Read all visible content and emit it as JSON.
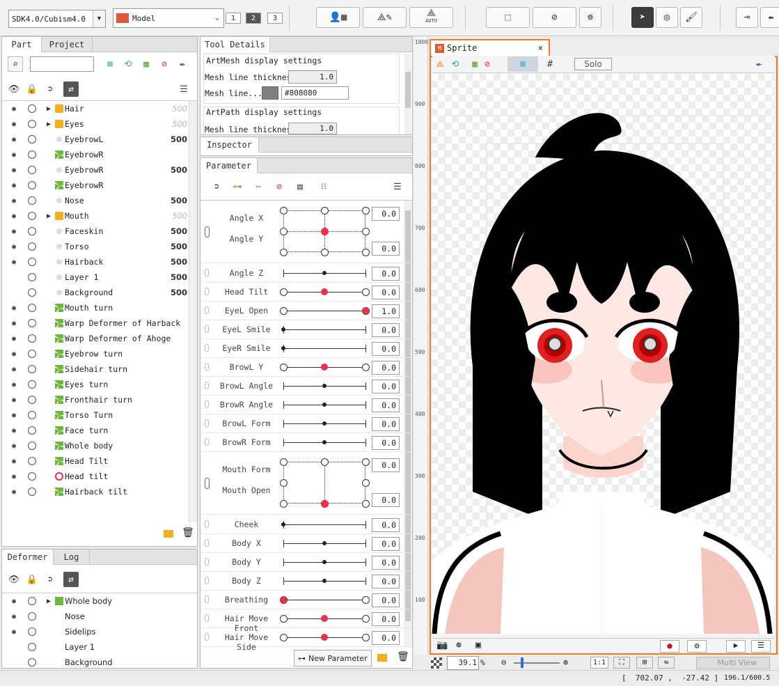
{
  "toolbar": {
    "sdk_select": "SDK4.0/Cubism4.0",
    "mode_select": "Model",
    "view_buttons": [
      "1",
      "2",
      "3"
    ],
    "selected_view": "2",
    "auto_label": "AUTO"
  },
  "part_panel": {
    "tabs": [
      "Part",
      "Project"
    ],
    "search_placeholder": "",
    "items": [
      {
        "label": "Hair",
        "order": "500",
        "folder": true,
        "expand": true,
        "visible": true,
        "dim": true
      },
      {
        "label": "Eyes",
        "order": "500",
        "folder": true,
        "expand": true,
        "visible": true,
        "dim": true
      },
      {
        "label": "EyebrowL",
        "order": "500",
        "icon": "mesh-icon",
        "visible": true
      },
      {
        "label": "EyebrowR",
        "order": "",
        "icon": "warp-icon",
        "visible": true
      },
      {
        "label": "EyebrowR",
        "order": "500",
        "icon": "mesh-icon",
        "visible": true
      },
      {
        "label": "EyebrowR",
        "order": "",
        "icon": "warp-icon",
        "visible": true
      },
      {
        "label": "Nose",
        "order": "500",
        "icon": "mesh-icon",
        "visible": true
      },
      {
        "label": "Mouth",
        "order": "500",
        "folder": true,
        "expand": true,
        "visible": true,
        "dim": true
      },
      {
        "label": "Faceskin",
        "order": "500",
        "icon": "mesh-icon",
        "visible": true
      },
      {
        "label": "Torso",
        "order": "500",
        "icon": "mesh-icon",
        "visible": true
      },
      {
        "label": "Hairback",
        "order": "500",
        "icon": "mesh-icon",
        "visible": true
      },
      {
        "label": "Layer 1",
        "order": "500",
        "icon": "mesh-icon",
        "visible": false
      },
      {
        "label": "Background",
        "order": "500",
        "icon": "mesh-icon",
        "visible": false
      },
      {
        "label": "Mouth turn",
        "order": "",
        "icon": "warp-icon",
        "visible": true
      },
      {
        "label": "Warp Deformer of Harback",
        "order": "",
        "icon": "warp-icon",
        "visible": true
      },
      {
        "label": "Warp Deformer of Ahoge",
        "order": "",
        "icon": "warp-icon",
        "visible": true
      },
      {
        "label": "Eyebrow turn",
        "order": "",
        "icon": "warp-icon",
        "visible": true
      },
      {
        "label": "Sidehair turn",
        "order": "",
        "icon": "warp-icon",
        "visible": true
      },
      {
        "label": "Eyes turn",
        "order": "",
        "icon": "warp-icon",
        "visible": true
      },
      {
        "label": "Fronthair turn",
        "order": "",
        "icon": "warp-icon",
        "visible": true
      },
      {
        "label": "Torso Turn",
        "order": "",
        "icon": "warp-icon",
        "visible": true
      },
      {
        "label": "Face turn",
        "order": "",
        "icon": "warp-icon",
        "visible": true
      },
      {
        "label": "Whole body",
        "order": "",
        "icon": "warp-icon",
        "visible": true
      },
      {
        "label": "Head Tilt",
        "order": "",
        "icon": "warp-icon",
        "visible": true
      },
      {
        "label": "Head tilt",
        "order": "",
        "icon": "rotation-icon",
        "visible": true
      },
      {
        "label": "Hairback tilt",
        "order": "",
        "icon": "warp-icon",
        "visible": true
      }
    ]
  },
  "deformer_panel": {
    "tabs": [
      "Deformer",
      "Log"
    ],
    "items": [
      {
        "label": "Whole body",
        "expand": true,
        "visible": true
      },
      {
        "label": "Nose",
        "visible": true
      },
      {
        "label": "Sidelips",
        "visible": true
      },
      {
        "label": "Layer 1",
        "visible": false
      },
      {
        "label": "Background",
        "visible": false
      }
    ]
  },
  "tool_details": {
    "tab": "Tool Details",
    "artmesh_header": "ArtMesh display settings",
    "mesh_line_thickness_label": "Mesh line thickness",
    "mesh_line_thickness_value": "1.0",
    "mesh_line_color_label": "Mesh line...",
    "mesh_line_color_value": "#808080",
    "artpath_header": "ArtPath display settings",
    "artpath_thickness_label": "Mesh line thickness",
    "artpath_thickness_value": "1.0"
  },
  "inspector": {
    "tab": "Inspector"
  },
  "parameter": {
    "tab": "Parameter",
    "angle_xy": {
      "label_x": "Angle X",
      "label_y": "Angle Y",
      "value_x": "0.0",
      "value_y": "0.0"
    },
    "rows": [
      {
        "label": "Angle Z",
        "value": "0.0",
        "pos": 0.5,
        "style": "plain"
      },
      {
        "label": "Head Tilt",
        "value": "0.0",
        "pos": 0.5,
        "style": "keys"
      },
      {
        "label": "EyeL Open",
        "value": "1.0",
        "pos": 1.0,
        "style": "keys"
      },
      {
        "label": "EyeL Smile",
        "value": "0.0",
        "pos": 0.0,
        "style": "plain"
      },
      {
        "label": "EyeR Smile",
        "value": "0.0",
        "pos": 0.0,
        "style": "plain"
      },
      {
        "label": "BrowL Y",
        "value": "0.0",
        "pos": 0.5,
        "style": "keys"
      },
      {
        "label": "BrowL Angle",
        "value": "0.0",
        "pos": 0.5,
        "style": "plain"
      },
      {
        "label": "BrowR Angle",
        "value": "0.0",
        "pos": 0.5,
        "style": "plain"
      },
      {
        "label": "BrowL Form",
        "value": "0.0",
        "pos": 0.5,
        "style": "plain"
      },
      {
        "label": "BrowR Form",
        "value": "0.0",
        "pos": 0.5,
        "style": "plain"
      }
    ],
    "mouth_xy": {
      "label_x": "Mouth Form",
      "label_y": "Mouth Open",
      "value_x": "0.0",
      "value_y": "0.0"
    },
    "rows2": [
      {
        "label": "Cheek",
        "value": "0.0",
        "pos": 0.0,
        "style": "plain"
      },
      {
        "label": "Body X",
        "value": "0.0",
        "pos": 0.5,
        "style": "plain"
      },
      {
        "label": "Body Y",
        "value": "0.0",
        "pos": 0.5,
        "style": "plain"
      },
      {
        "label": "Body Z",
        "value": "0.0",
        "pos": 0.5,
        "style": "plain"
      },
      {
        "label": "Breathing",
        "value": "0.0",
        "pos": 0.0,
        "style": "keys"
      },
      {
        "label": "Hair Move Front",
        "value": "0.0",
        "pos": 0.5,
        "style": "keys"
      },
      {
        "label": "Hair Move Side",
        "value": "0.0",
        "pos": 0.5,
        "style": "keys"
      }
    ],
    "new_parameter_label": "New Parameter"
  },
  "viewport": {
    "tab": "Sprite",
    "solo_label": "Solo",
    "ruler_labels": [
      "1000",
      "900",
      "800",
      "700",
      "600",
      "500",
      "400",
      "300",
      "200",
      "100"
    ],
    "zoom_value": "39.1",
    "zoom_unit": "%",
    "ratio_label": "1:1",
    "multi_view_label": "Multi View"
  },
  "status": {
    "coordinates": "[  702.07 ,  -27.42 ]",
    "memory": "196.1/600.5"
  },
  "colors": {
    "accent_orange": "#f47a20",
    "keyframe_red": "#e9304d",
    "warp_green": "#5ba831"
  }
}
